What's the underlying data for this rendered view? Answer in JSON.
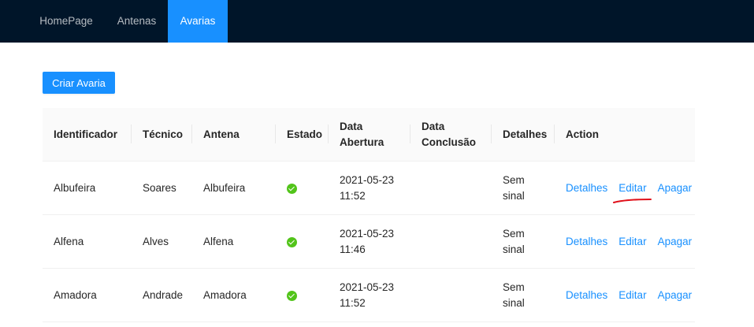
{
  "nav": {
    "items": [
      {
        "label": "HomePage"
      },
      {
        "label": "Antenas"
      },
      {
        "label": "Avarias",
        "active": true
      }
    ]
  },
  "create_button": {
    "label": "Criar Avaria"
  },
  "table": {
    "headers": [
      "Identificador",
      "Técnico",
      "Antena",
      "Estado",
      "Data Abertura",
      "Data Conclusão",
      "Detalhes",
      "Action"
    ],
    "rows": [
      {
        "identificador": "Albufeira",
        "tecnico": "Soares",
        "antena": "Albufeira",
        "estado": "check-circle-icon",
        "data_abertura": "2021-05-23 11:52",
        "data_conclusao": "",
        "detalhes": "Sem sinal"
      },
      {
        "identificador": "Alfena",
        "tecnico": "Alves",
        "antena": "Alfena",
        "estado": "check-circle-icon",
        "data_abertura": "2021-05-23 11:46",
        "data_conclusao": "",
        "detalhes": "Sem sinal"
      },
      {
        "identificador": "Amadora",
        "tecnico": "Andrade",
        "antena": "Amadora",
        "estado": "check-circle-icon",
        "data_abertura": "2021-05-23 11:52",
        "data_conclusao": "",
        "detalhes": "Sem sinal"
      }
    ],
    "actions": {
      "details": "Detalhes",
      "edit": "Editar",
      "delete": "Apagar"
    }
  },
  "colors": {
    "nav_bg": "#001529",
    "accent": "#1890ff",
    "status_ok": "#52c41a",
    "annotation": "#e0101a"
  }
}
